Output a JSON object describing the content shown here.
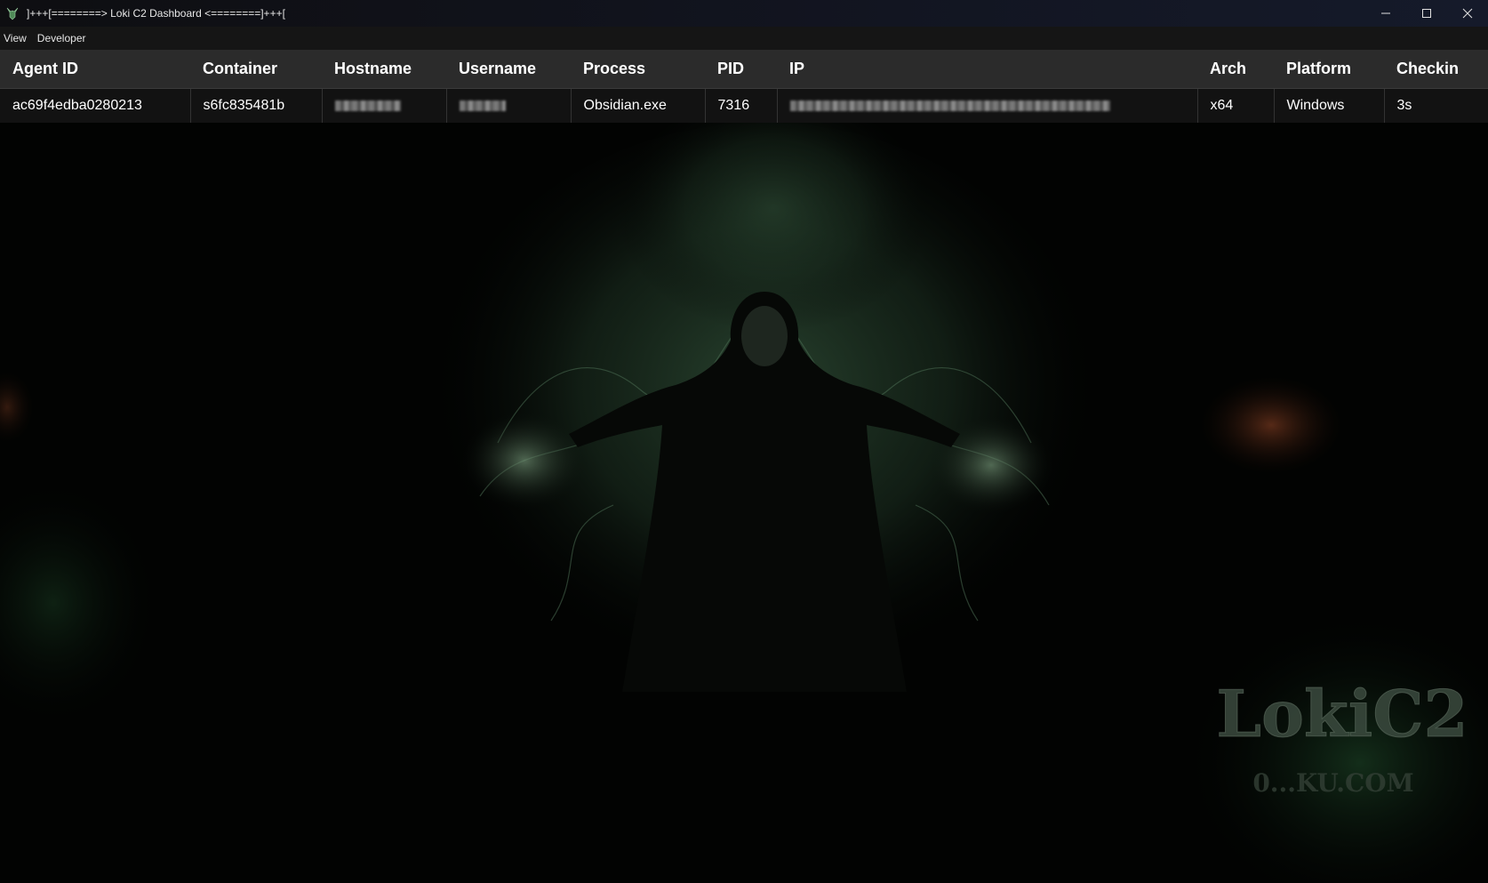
{
  "window": {
    "title": "]+++[========> Loki C2 Dashboard <========]+++[",
    "controls": [
      "minimize",
      "maximize",
      "close"
    ]
  },
  "menu": {
    "items": [
      {
        "label": "View"
      },
      {
        "label": "Developer"
      }
    ]
  },
  "table": {
    "columns": [
      "Agent ID",
      "Container",
      "Hostname",
      "Username",
      "Process",
      "PID",
      "IP",
      "Arch",
      "Platform",
      "Checkin"
    ],
    "rows": [
      {
        "agent_id": "ac69f4edba0280213",
        "container": "s6fc835481b",
        "hostname": "[redacted]",
        "username": "[redacted]",
        "process": "Obsidian.exe",
        "pid": "7316",
        "ip": "[redacted]",
        "arch": "x64",
        "platform": "Windows",
        "checkin": "3s"
      }
    ]
  },
  "background": {
    "watermark_logo": "LokiC2",
    "watermark_site": "0...KU.COM",
    "accent_color": "#3f7a4a"
  }
}
